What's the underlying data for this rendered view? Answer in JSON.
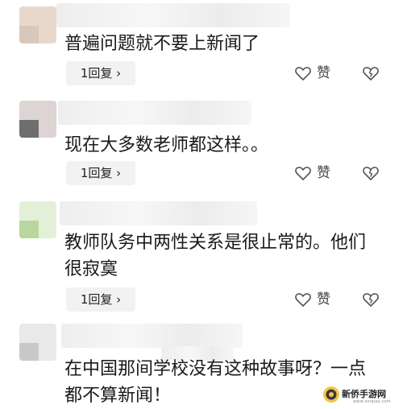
{
  "comments": [
    {
      "text_lines": [
        "普遍问题就不要上新闻了"
      ],
      "reply_label": "1回复 ›",
      "like_label": "赞",
      "avatar_colors": [
        "#e8d8cc",
        "#d8c8bb"
      ]
    },
    {
      "text_lines": [
        "现在大多数老师都这样。。"
      ],
      "reply_label": "1回复 ›",
      "like_label": "赞",
      "avatar_colors": [
        "#ddd4d4",
        "#6e6e6e"
      ]
    },
    {
      "text_lines": [
        "教师队务中两性关系是很止常的。他们",
        "很寂寞"
      ],
      "reply_label": "1回复 ›",
      "like_label": "赞",
      "avatar_colors": [
        "#e4efd8",
        "#b9d79c"
      ]
    },
    {
      "text_lines": [
        "在中国那间学校没有这种故事呀？一点",
        "都不算新闻！"
      ],
      "reply_label": "",
      "like_label": "",
      "avatar_colors": [
        "#e9e9e9",
        "#c8c8c8"
      ]
    }
  ],
  "watermark": {
    "text": "新侨手游网",
    "subtext": "www.xinqiao.com"
  },
  "colors": {
    "text": "#1a1a1a",
    "reply_bg": "#f2f2f2",
    "icon": "#555555"
  }
}
